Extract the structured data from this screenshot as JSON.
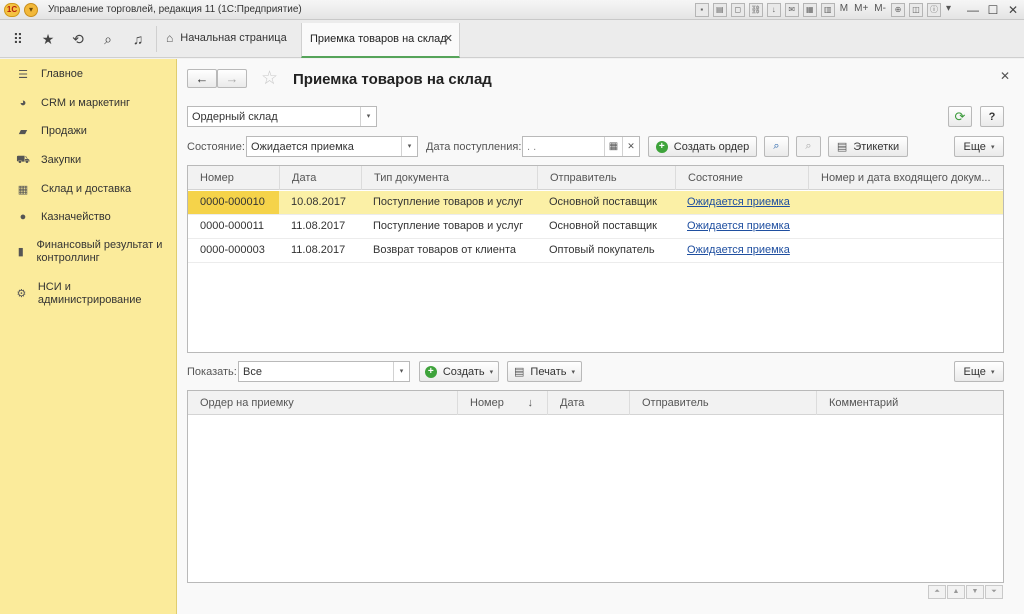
{
  "window": {
    "logo_text": "1С",
    "title": "Управление торговлей, редакция 11  (1С:Предприятие)",
    "tools_text": [
      "M",
      "M+",
      "M-"
    ]
  },
  "tabs": {
    "home_label": "Начальная страница",
    "active_label": "Приемка товаров на склад"
  },
  "sidebar": {
    "items": [
      {
        "label": "Главное",
        "icon": "menu-lines-icon"
      },
      {
        "label": "CRM и маркетинг",
        "icon": "pie-chart-icon"
      },
      {
        "label": "Продажи",
        "icon": "briefcase-icon"
      },
      {
        "label": "Закупки",
        "icon": "cart-icon"
      },
      {
        "label": "Склад и доставка",
        "icon": "grid-icon"
      },
      {
        "label": "Казначейство",
        "icon": "coin-icon"
      },
      {
        "label": "Финансовый результат и контроллинг",
        "icon": "bar-chart-icon"
      },
      {
        "label": "НСИ и администрирование",
        "icon": "gear-icon"
      }
    ]
  },
  "form": {
    "title": "Приемка товаров на склад",
    "warehouse_value": "Ордерный склад",
    "state_label": "Состояние:",
    "state_value": "Ожидается приемка",
    "date_label": "Дата поступления:",
    "date_value": " .  .",
    "create_order_label": "Создать ордер",
    "labels_button": "Этикетки",
    "more_label": "Еще",
    "help_label": "?"
  },
  "table1": {
    "columns": [
      "Номер",
      "Дата",
      "Тип документа",
      "Отправитель",
      "Состояние",
      "Номер и дата входящего докум..."
    ],
    "rows": [
      {
        "num": "0000-000010",
        "date": "10.08.2017",
        "type": "Поступление товаров и услуг",
        "sender": "Основной поставщик",
        "state": "Ожидается приемка",
        "incoming": ""
      },
      {
        "num": "0000-000011",
        "date": "11.08.2017",
        "type": "Поступление товаров и услуг",
        "sender": "Основной поставщик",
        "state": "Ожидается приемка",
        "incoming": ""
      },
      {
        "num": "0000-000003",
        "date": "11.08.2017",
        "type": "Возврат товаров от клиента",
        "sender": "Оптовый покупатель",
        "state": "Ожидается приемка",
        "incoming": ""
      }
    ]
  },
  "lower": {
    "show_label": "Показать:",
    "show_value": "Все",
    "create_label": "Создать",
    "print_label": "Печать",
    "more_label": "Еще"
  },
  "table2": {
    "columns": [
      "Ордер на приемку",
      "Номер",
      "Дата",
      "Отправитель",
      "Комментарий"
    ],
    "sort_arrow": "↓"
  }
}
